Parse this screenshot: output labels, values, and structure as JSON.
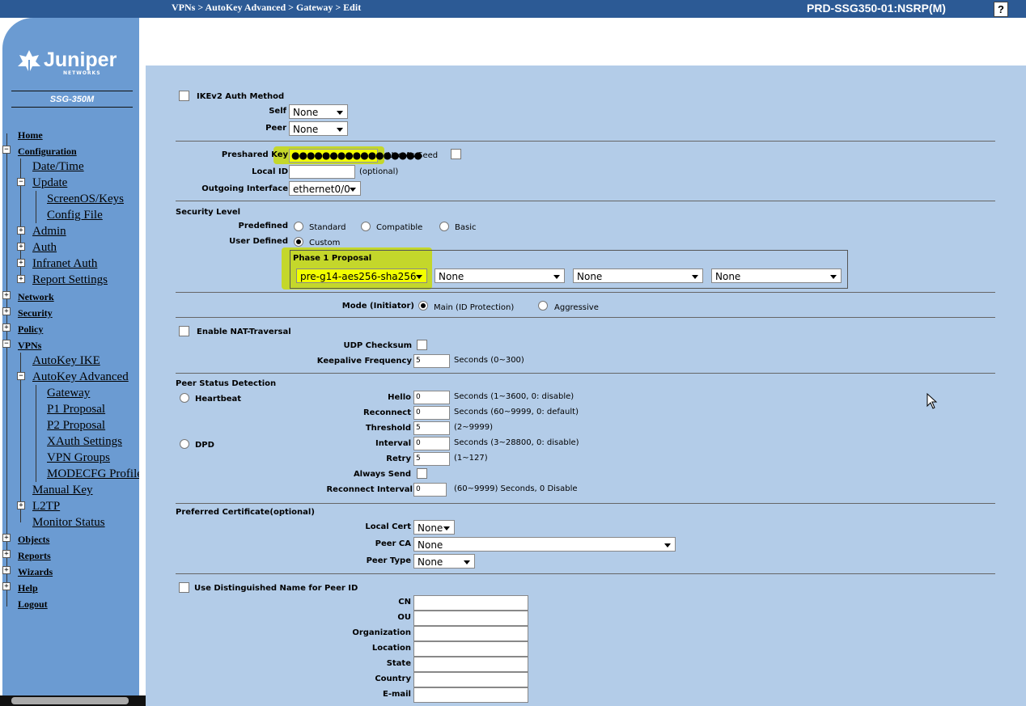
{
  "header": {
    "breadcrumb": "VPNs > AutoKey Advanced > Gateway > Edit",
    "device": "PRD-SSG350-01:NSRP(M)",
    "help": "?"
  },
  "brand": {
    "name": "Juniper",
    "sub": "NETWORKS",
    "model": "SSG-350M"
  },
  "nav": {
    "home": "Home",
    "configuration": "Configuration",
    "date_time": "Date/Time",
    "update": "Update",
    "screenos_keys": "ScreenOS/Keys",
    "config_file": "Config File",
    "admin": "Admin",
    "auth": "Auth",
    "infranet_auth": "Infranet Auth",
    "report_settings": "Report Settings",
    "network": "Network",
    "security": "Security",
    "policy": "Policy",
    "vpns": "VPNs",
    "autokey_ike": "AutoKey IKE",
    "autokey_advanced": "AutoKey Advanced",
    "gateway": "Gateway",
    "p1_proposal": "P1 Proposal",
    "p2_proposal": "P2 Proposal",
    "xauth_settings": "XAuth Settings",
    "vpn_groups": "VPN Groups",
    "modecfg_profile": "MODECFG Profile",
    "manual_key": "Manual Key",
    "l2tp": "L2TP",
    "monitor_status": "Monitor Status",
    "objects": "Objects",
    "reports": "Reports",
    "wizards": "Wizards",
    "help": "Help",
    "logout": "Logout"
  },
  "ikev2": {
    "label": "IKEv2 Auth Method",
    "self_label": "Self",
    "self_value": "None",
    "peer_label": "Peer",
    "peer_value": "None"
  },
  "auth": {
    "preshared_label": "Preshared Key",
    "preshared_mask": "●●●●●●●●●●●●●●●●●",
    "use_as_seed": "Use As Seed",
    "local_id_label": "Local ID",
    "local_id_value": "",
    "optional": "(optional)",
    "outgoing_label": "Outgoing Interface",
    "outgoing_value": "ethernet0/0"
  },
  "security_level": {
    "title": "Security Level",
    "predefined": "Predefined",
    "standard": "Standard",
    "compatible": "Compatible",
    "basic": "Basic",
    "user_defined": "User Defined",
    "custom": "Custom",
    "phase1_title": "Phase 1 Proposal",
    "proposals": [
      "pre-g14-aes256-sha256",
      "None",
      "None",
      "None"
    ]
  },
  "mode": {
    "label": "Mode (Initiator)",
    "main": "Main (ID Protection)",
    "aggressive": "Aggressive"
  },
  "nat": {
    "label": "Enable NAT-Traversal",
    "udp_checksum": "UDP Checksum",
    "keepalive_label": "Keepalive Frequency",
    "keepalive_value": "5",
    "keepalive_unit": "Seconds (0~300)"
  },
  "psd": {
    "title": "Peer Status Detection",
    "heartbeat": "Heartbeat",
    "dpd": "DPD",
    "hello_label": "Hello",
    "hello_value": "0",
    "hello_unit": "Seconds (1~3600, 0: disable)",
    "reconnect_label": "Reconnect",
    "reconnect_value": "0",
    "reconnect_unit": "Seconds (60~9999, 0: default)",
    "threshold_label": "Threshold",
    "threshold_value": "5",
    "threshold_unit": "(2~9999)",
    "interval_label": "Interval",
    "interval_value": "0",
    "interval_unit": "Seconds (3~28800, 0: disable)",
    "retry_label": "Retry",
    "retry_value": "5",
    "retry_unit": "(1~127)",
    "always_send": "Always Send",
    "reconnect_interval_label": "Reconnect Interval",
    "reconnect_interval_value": "0",
    "reconnect_interval_unit": "(60~9999) Seconds, 0 Disable"
  },
  "cert": {
    "title": "Preferred Certificate(optional)",
    "local_cert_label": "Local Cert",
    "local_cert_value": "None",
    "peer_ca_label": "Peer CA",
    "peer_ca_value": "None",
    "peer_type_label": "Peer Type",
    "peer_type_value": "None"
  },
  "dn": {
    "label": "Use Distinguished Name for Peer ID",
    "fields": [
      "CN",
      "OU",
      "Organization",
      "Location",
      "State",
      "Country",
      "E-mail"
    ]
  }
}
